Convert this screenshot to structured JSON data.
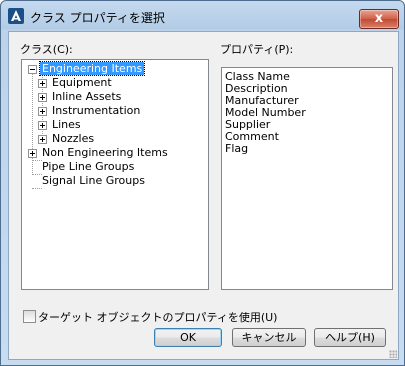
{
  "window": {
    "title": "クラス プロパティを選択",
    "close_glyph": "x"
  },
  "class_panel": {
    "label": "クラス(C):",
    "tree": {
      "engineering": "Engineering Items",
      "equipment": "Equipment",
      "inline_assets": "Inline Assets",
      "instrumentation": "Instrumentation",
      "lines": "Lines",
      "nozzles": "Nozzles",
      "non_engineering": "Non Engineering Items",
      "pipe_line_groups": "Pipe Line Groups",
      "signal_line_groups": "Signal Line Groups"
    }
  },
  "property_panel": {
    "label": "プロパティ(P):",
    "items": [
      "Class Name",
      "Description",
      "Manufacturer",
      "Model Number",
      "Supplier",
      "Comment",
      "Flag"
    ]
  },
  "target_checkbox": {
    "label": "ターゲット オブジェクトのプロパティを使用(U)",
    "checked": false
  },
  "buttons": {
    "ok": "OK",
    "cancel": "キャンセル",
    "help": "ヘルプ(H)"
  },
  "colors": {
    "selection": "#3399ff",
    "titlebar": "#c4d9ee",
    "close": "#c24a30"
  }
}
